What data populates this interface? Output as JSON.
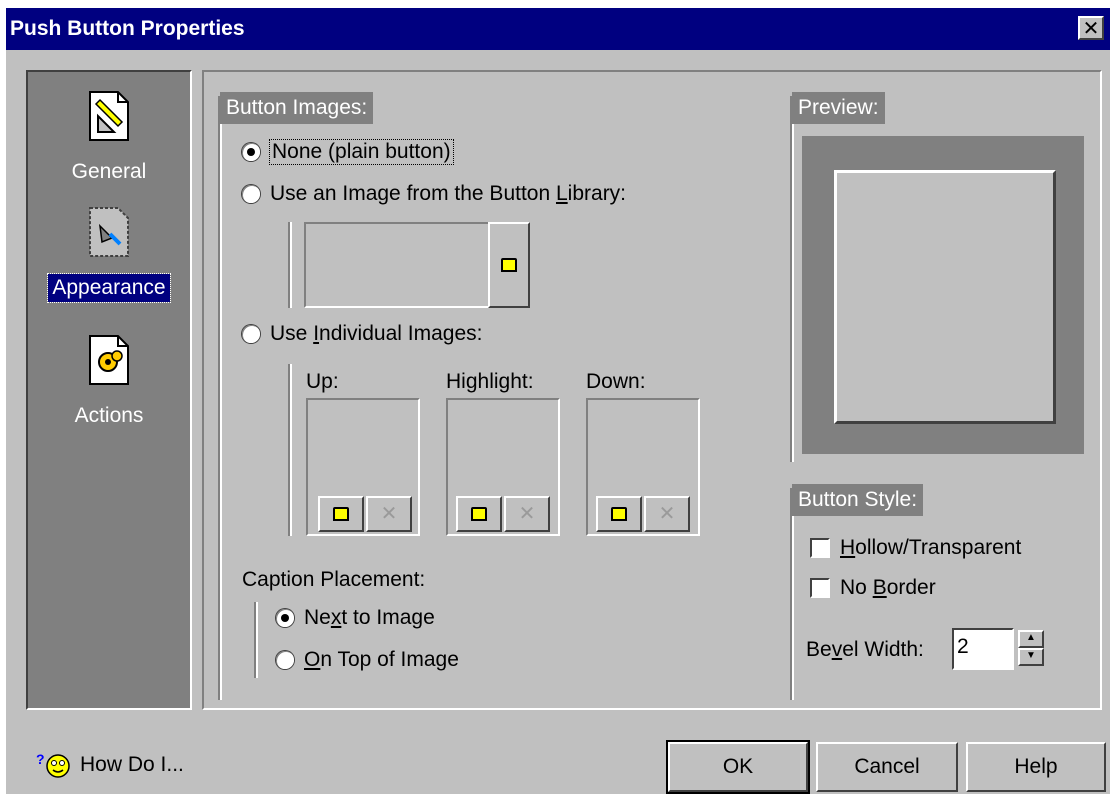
{
  "window": {
    "title": "Push Button Properties",
    "close": "✕"
  },
  "sidebar": {
    "items": [
      {
        "label": "General",
        "icon": "pencil-ruler-icon"
      },
      {
        "label": "Appearance",
        "icon": "appearance-icon",
        "selected": true
      },
      {
        "label": "Actions",
        "icon": "gears-icon"
      }
    ]
  },
  "button_images": {
    "title": "Button Images:",
    "opt_none": "None (plain button)",
    "opt_library_pre": "Use an Image from the Button ",
    "opt_library_u": "L",
    "opt_library_post": "ibrary:",
    "opt_individual_pre": "Use ",
    "opt_individual_u": "I",
    "opt_individual_post": "ndividual Images:",
    "selected": "none",
    "up_label": "Up:",
    "highlight_label": "Highlight:",
    "down_label": "Down:"
  },
  "caption": {
    "title": "Caption Placement:",
    "next_pre": "Ne",
    "next_u": "x",
    "next_post": "t to Image",
    "top_u": "O",
    "top_post": "n Top of Image",
    "selected": "next"
  },
  "preview": {
    "title": "Preview:"
  },
  "button_style": {
    "title": "Button Style:",
    "hollow_u": "H",
    "hollow_post": "ollow/Transparent",
    "hollow_checked": false,
    "noborder_pre": "No ",
    "noborder_u": "B",
    "noborder_post": "order",
    "noborder_checked": false,
    "bevel_pre": "Be",
    "bevel_u": "v",
    "bevel_post": "el Width:",
    "bevel_value": "2"
  },
  "footer": {
    "howdoi": "How Do I...",
    "ok": "OK",
    "cancel": "Cancel",
    "help": "Help"
  }
}
